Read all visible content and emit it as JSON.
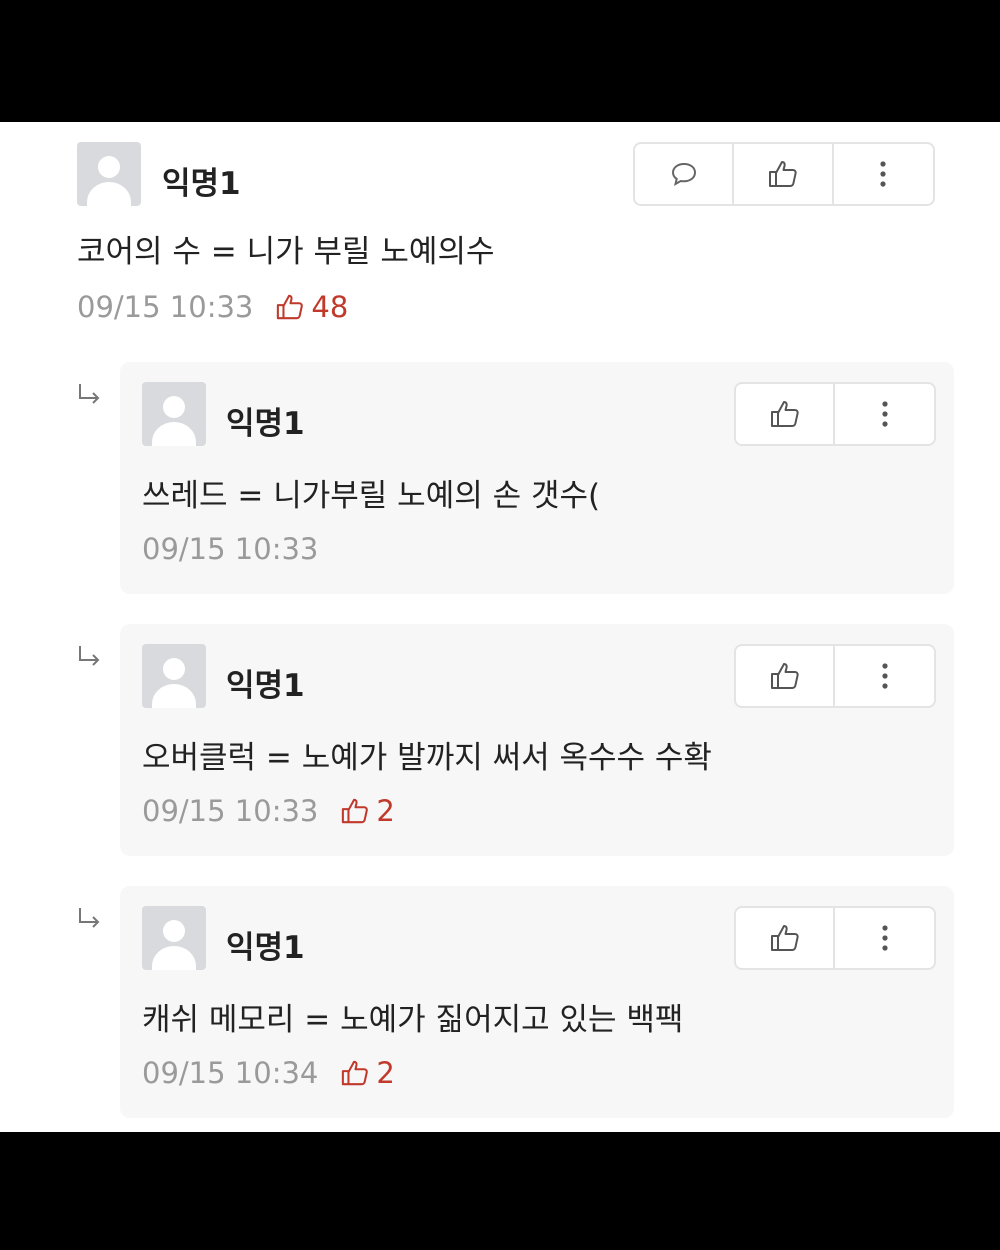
{
  "comments": [
    {
      "author": "익명1",
      "text": "코어의 수 = 니가 부릴 노예의수",
      "time": "09/15 10:33",
      "likes": "48"
    },
    {
      "author": "익명1",
      "text": "쓰레드 = 니가부릴 노예의 손 갯수(",
      "time": "09/15 10:33",
      "likes": ""
    },
    {
      "author": "익명1",
      "text": "오버클럭 = 노예가 발까지 써서 옥수수 수확",
      "time": "09/15 10:33",
      "likes": "2"
    },
    {
      "author": "익명1",
      "text": "캐쉬 메모리 = 노예가 짊어지고 있는 백팩",
      "time": "09/15 10:34",
      "likes": "2"
    }
  ],
  "icons": {
    "reply": "speech-bubble-icon",
    "like": "thumbs-up-icon",
    "more": "more-vertical-icon",
    "reply_arrow": "reply-arrow-icon"
  },
  "colors": {
    "like_count": "#c0392b",
    "meta": "#9a9a9a"
  }
}
